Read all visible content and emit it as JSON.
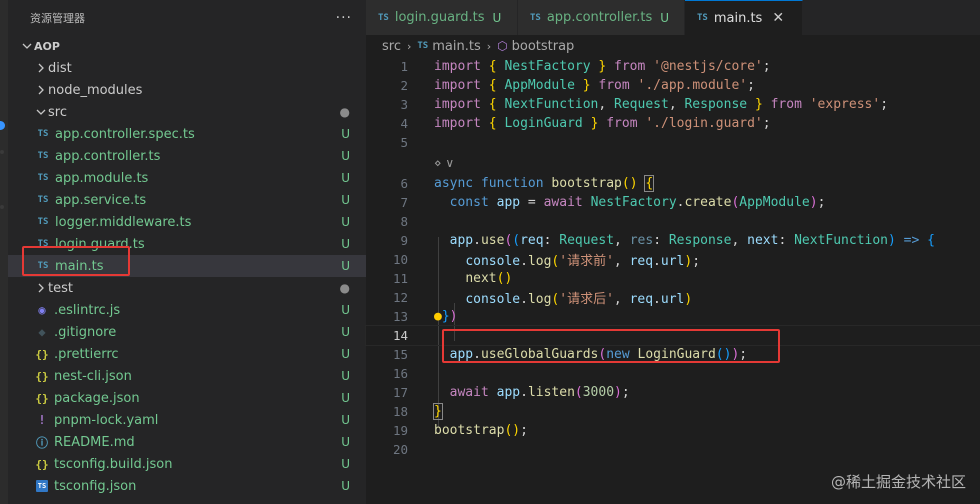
{
  "explorer": {
    "title": "资源管理器",
    "more": "···",
    "root": "AOP",
    "items": [
      {
        "label": "dist",
        "kind": "folder",
        "status": ""
      },
      {
        "label": "node_modules",
        "kind": "folder",
        "status": ""
      },
      {
        "label": "src",
        "kind": "folder-open",
        "status": "●"
      },
      {
        "label": "app.controller.spec.ts",
        "icon": "TS",
        "status": "U"
      },
      {
        "label": "app.controller.ts",
        "icon": "TS",
        "status": "U"
      },
      {
        "label": "app.module.ts",
        "icon": "TS",
        "status": "U"
      },
      {
        "label": "app.service.ts",
        "icon": "TS",
        "status": "U"
      },
      {
        "label": "logger.middleware.ts",
        "icon": "TS",
        "status": "U"
      },
      {
        "label": "login.guard.ts",
        "icon": "TS",
        "status": "U"
      },
      {
        "label": "main.ts",
        "icon": "TS",
        "status": "U"
      },
      {
        "label": "test",
        "kind": "folder",
        "status": "●"
      },
      {
        "label": ".eslintrc.js",
        "icon": "◉",
        "status": "U"
      },
      {
        "label": ".gitignore",
        "icon": "◆",
        "status": "U"
      },
      {
        "label": ".prettierrc",
        "icon": "{}",
        "status": "U"
      },
      {
        "label": "nest-cli.json",
        "icon": "{}",
        "status": "U"
      },
      {
        "label": "package.json",
        "icon": "{}",
        "status": "U"
      },
      {
        "label": "pnpm-lock.yaml",
        "icon": "!",
        "status": "U"
      },
      {
        "label": "README.md",
        "icon": "ⓘ",
        "status": "U"
      },
      {
        "label": "tsconfig.build.json",
        "icon": "{}",
        "status": "U"
      },
      {
        "label": "tsconfig.json",
        "icon": "TS",
        "status": "U"
      }
    ]
  },
  "tabs": [
    {
      "icon": "TS",
      "label": "login.guard.ts",
      "status": "U",
      "active": false
    },
    {
      "icon": "TS",
      "label": "app.controller.ts",
      "status": "U",
      "active": false
    },
    {
      "icon": "TS",
      "label": "main.ts",
      "status": "U",
      "active": true,
      "close": "✕"
    }
  ],
  "breadcrumb": {
    "folder": "src",
    "file_icon": "TS",
    "file": "main.ts",
    "symbol": "bootstrap"
  },
  "editor": {
    "current_line": 14,
    "line_numbers": [
      "1",
      "2",
      "3",
      "4",
      "5",
      "",
      "6",
      "7",
      "8",
      "9",
      "10",
      "11",
      "12",
      "13",
      "14",
      "15",
      "16",
      "17",
      "18",
      "19",
      "20"
    ],
    "codelens": "⋄ ∨"
  },
  "watermark": "@稀土掘金技术社区",
  "colors": {
    "accent": "#0078d4",
    "highlight_box": "#e53935",
    "untracked": "#73c991"
  }
}
